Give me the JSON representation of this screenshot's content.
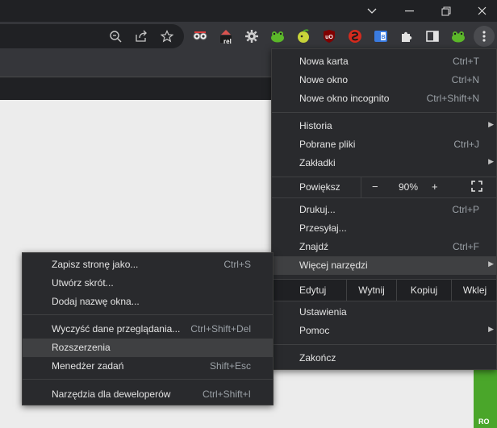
{
  "menu": {
    "new_tab": {
      "label": "Nowa karta",
      "shortcut": "Ctrl+T"
    },
    "new_window": {
      "label": "Nowe okno",
      "shortcut": "Ctrl+N"
    },
    "incognito": {
      "label": "Nowe okno incognito",
      "shortcut": "Ctrl+Shift+N"
    },
    "history": {
      "label": "Historia"
    },
    "downloads": {
      "label": "Pobrane pliki",
      "shortcut": "Ctrl+J"
    },
    "bookmarks": {
      "label": "Zakładki"
    },
    "zoom": {
      "label": "Powiększ",
      "minus": "−",
      "value": "90%",
      "plus": "+"
    },
    "print": {
      "label": "Drukuj...",
      "shortcut": "Ctrl+P"
    },
    "cast": {
      "label": "Przesyłaj..."
    },
    "find": {
      "label": "Znajdź",
      "shortcut": "Ctrl+F"
    },
    "more_tools": {
      "label": "Więcej narzędzi"
    },
    "edit": {
      "label": "Edytuj",
      "cut": "Wytnij",
      "copy": "Kopiuj",
      "paste": "Wklej"
    },
    "settings": {
      "label": "Ustawienia"
    },
    "help": {
      "label": "Pomoc"
    },
    "exit": {
      "label": "Zakończ"
    }
  },
  "submenu": {
    "save_page": {
      "label": "Zapisz stronę jako...",
      "shortcut": "Ctrl+S"
    },
    "create_shortcut": {
      "label": "Utwórz skrót..."
    },
    "name_window": {
      "label": "Dodaj nazwę okna..."
    },
    "clear_data": {
      "label": "Wyczyść dane przeglądania...",
      "shortcut": "Ctrl+Shift+Del"
    },
    "extensions": {
      "label": "Rozszerzenia"
    },
    "task_manager": {
      "label": "Menedżer zadań",
      "shortcut": "Shift+Esc"
    },
    "dev_tools": {
      "label": "Narzędzia dla deweloperów",
      "shortcut": "Ctrl+Shift+I"
    }
  },
  "extensions_toolbar": {
    "rel_badge": "rel",
    "icons": [
      "reader-icon",
      "rel-icon",
      "gear-icon",
      "frog-icon",
      "lemon-icon",
      "ublock-icon",
      "shield-red-icon",
      "translate-icon",
      "puzzle-icon",
      "sidepanel-icon",
      "frog-icon-2",
      "kebab-icon"
    ]
  },
  "page": {
    "partial_label": "RO"
  },
  "colors": {
    "frame": "#202124",
    "toolbar": "#35363a",
    "menu_bg": "#292a2d",
    "menu_highlight": "#3f4042",
    "text": "#e3e3e3",
    "shortcut_text": "#9aa0a6",
    "green_bar": "#4aa62a"
  }
}
